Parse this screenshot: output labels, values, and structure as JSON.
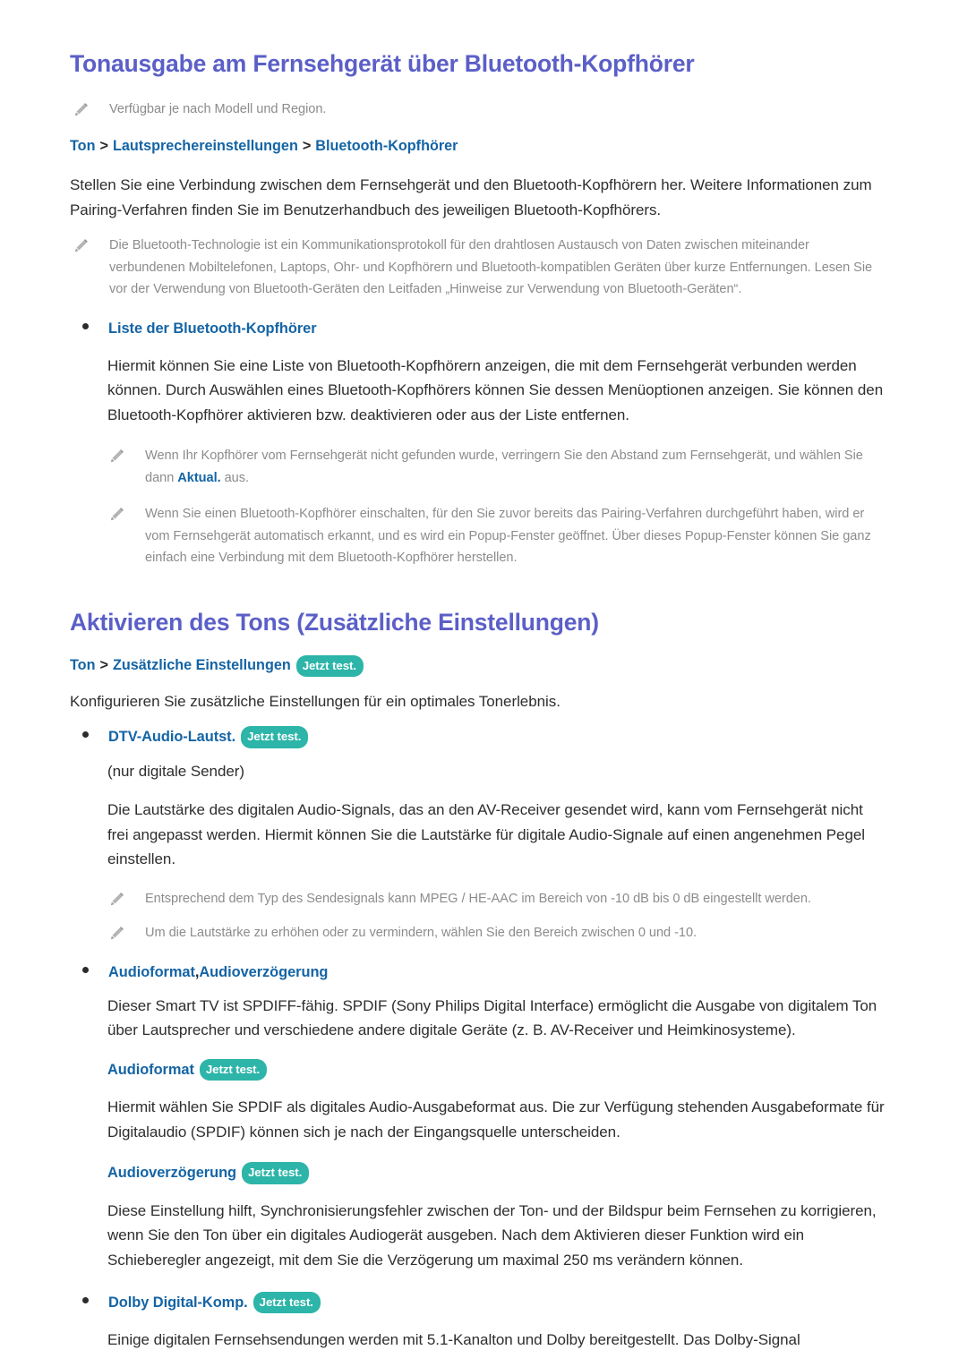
{
  "page": {
    "language": "de",
    "background_color": "#ffffff",
    "heading_color": "#5b5fc7",
    "link_color": "#1464a5",
    "body_color": "#2e2e2e",
    "note_color": "#8c8c8c",
    "badge_color": "#2cb5a8",
    "badge_text_color": "#ffffff"
  },
  "section1": {
    "title": "Tonausgabe am Fernsehgerät über Bluetooth-Kopfhörer",
    "note_availability": "Verfügbar je nach Modell und Region.",
    "breadcrumb": {
      "parts": [
        "Ton",
        "Lautsprechereinstellungen",
        "Bluetooth-Kopfhörer"
      ],
      "separator": ">"
    },
    "intro": "Stellen Sie eine Verbindung zwischen dem Fernsehgerät und den Bluetooth-Kopfhörern her. Weitere Informationen zum Pairing-Verfahren finden Sie im Benutzerhandbuch des jeweiligen Bluetooth-Kopfhörers.",
    "note_bluetooth": "Die Bluetooth-Technologie ist ein Kommunikationsprotokoll für den drahtlosen Austausch von Daten zwischen miteinander verbundenen Mobiltelefonen, Laptops, Ohr- und Kopfhörern und Bluetooth-kompatiblen Geräten über kurze Entfernungen. Lesen Sie vor der Verwendung von Bluetooth-Geräten den Leitfaden „Hinweise zur Verwendung von Bluetooth-Geräten“.",
    "bullet_liste": {
      "label": "Liste der Bluetooth-Kopfhörer",
      "body": "Hiermit können Sie eine Liste von Bluetooth-Kopfhörern anzeigen, die mit dem Fernsehgerät verbunden werden können. Durch Auswählen eines Bluetooth-Kopfhörers können Sie dessen Menüoptionen anzeigen. Sie können den Bluetooth-Kopfhörer aktivieren bzw. deaktivieren oder aus der Liste entfernen.",
      "note1_pre": "Wenn Ihr Kopfhörer vom Fernsehgerät nicht gefunden wurde, verringern Sie den Abstand zum Fernsehgerät, und wählen Sie dann ",
      "note1_bold": "Aktual.",
      "note1_post": " aus.",
      "note2": "Wenn Sie einen Bluetooth-Kopfhörer einschalten, für den Sie zuvor bereits das Pairing-Verfahren durchgeführt haben, wird er vom Fernsehgerät automatisch erkannt, und es wird ein Popup-Fenster geöffnet. Über dieses Popup-Fenster können Sie ganz einfach eine Verbindung mit dem Bluetooth-Kopfhörer herstellen."
    }
  },
  "section2": {
    "title": "Aktivieren des Tons (Zusätzliche Einstellungen)",
    "breadcrumb": {
      "parts": [
        "Ton",
        "Zusätzliche Einstellungen"
      ],
      "separator": ">",
      "badge": "Jetzt test."
    },
    "intro": "Konfigurieren Sie zusätzliche Einstellungen für ein optimales Tonerlebnis.",
    "bullet_dtv": {
      "label": "DTV-Audio-Lautst.",
      "badge": "Jetzt test.",
      "subnote": "(nur digitale Sender)",
      "body": "Die Lautstärke des digitalen Audio-Signals, das an den AV-Receiver gesendet wird, kann vom Fernsehgerät nicht frei angepasst werden. Hiermit können Sie die Lautstärke für digitale Audio-Signale auf einen angenehmen Pegel einstellen.",
      "note1": "Entsprechend dem Typ des Sendesignals kann MPEG / HE-AAC im Bereich von -10 dB bis 0 dB eingestellt werden.",
      "note2": "Um die Lautstärke zu erhöhen oder zu vermindern, wählen Sie den Bereich zwischen 0 und -10."
    },
    "bullet_audio": {
      "label_part1": "Audioformat",
      "label_comma": ",",
      "label_part2": " Audioverzögerung",
      "body": "Dieser Smart TV ist SPDIFF-fähig. SPDIF (Sony Philips Digital Interface) ermöglicht die Ausgabe von digitalem Ton über Lautsprecher und verschiedene andere digitale Geräte (z. B. AV-Receiver und Heimkinosysteme).",
      "sub_audioformat": {
        "label": "Audioformat",
        "badge": "Jetzt test.",
        "body": "Hiermit wählen Sie SPDIF als digitales Audio-Ausgabeformat aus. Die zur Verfügung stehenden Ausgabeformate für Digitalaudio (SPDIF) können sich je nach der Eingangsquelle unterscheiden."
      },
      "sub_audioverzoegerung": {
        "label": "Audioverzögerung",
        "badge": "Jetzt test.",
        "body": "Diese Einstellung hilft, Synchronisierungsfehler zwischen der Ton- und der Bildspur beim Fernsehen zu korrigieren, wenn Sie den Ton über ein digitales Audiogerät ausgeben. Nach dem Aktivieren dieser Funktion wird ein Schieberegler angezeigt, mit dem Sie die Verzögerung um maximal 250 ms verändern können."
      }
    },
    "bullet_dolby": {
      "label": "Dolby Digital-Komp.",
      "badge": "Jetzt test.",
      "body": "Einige digitalen Fernsehsendungen werden mit 5.1-Kanalton und Dolby bereitgestellt. Das Dolby-Signal"
    }
  },
  "icons": {
    "note": "pencil-icon",
    "bullet": "bullet-dot-icon"
  }
}
